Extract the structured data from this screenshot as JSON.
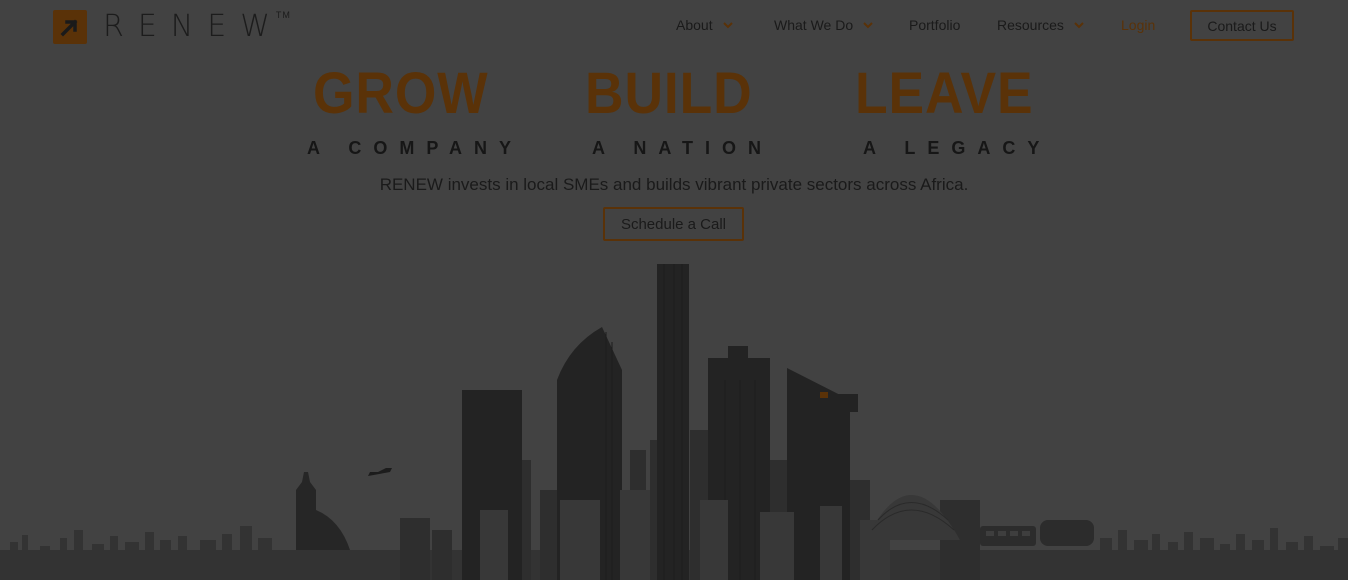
{
  "brand": {
    "name": "RENEW",
    "trademark": "TM",
    "accent_color": "#5a3208"
  },
  "nav": {
    "items": [
      {
        "label": "About",
        "has_dropdown": true
      },
      {
        "label": "What We Do",
        "has_dropdown": true
      },
      {
        "label": "Portfolio",
        "has_dropdown": false
      },
      {
        "label": "Resources",
        "has_dropdown": true
      }
    ],
    "login_label": "Login",
    "contact_label": "Contact Us"
  },
  "hero": {
    "pillars": [
      {
        "word": "GROW",
        "sub": "A COMPANY"
      },
      {
        "word": "BUILD",
        "sub": "A NATION"
      },
      {
        "word": "LEAVE",
        "sub": "A LEGACY"
      }
    ],
    "tagline": "RENEW invests in local SMEs and builds vibrant private sectors across Africa.",
    "cta_label": "Schedule a Call"
  }
}
